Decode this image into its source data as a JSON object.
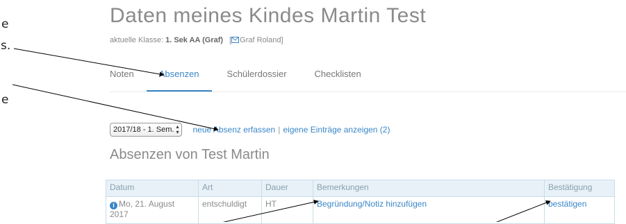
{
  "clipped_left": {
    "line1": "e",
    "line2": "s.",
    "line3": "e"
  },
  "page": {
    "title": "Daten meines Kindes Martin Test",
    "class_prefix": "aktuelle Klasse:",
    "class_value": "1. Sek AA (Graf)",
    "teacher": "Graf Roland",
    "teacher_bracket_open": "[",
    "teacher_bracket_close": "]"
  },
  "tabs": [
    {
      "label": "Noten"
    },
    {
      "label": "Absenzen"
    },
    {
      "label": "Schülerdossier"
    },
    {
      "label": "Checklisten"
    }
  ],
  "toolbar": {
    "semester_value": "2017/18 - 1. Sem.",
    "new_absence_link": "neue Absenz erfassen",
    "separator": "|",
    "own_entries_link": "eigene Einträge anzeigen (2)"
  },
  "section": {
    "title": "Absenzen von Test Martin"
  },
  "table": {
    "headers": [
      "Datum",
      "Art",
      "Dauer",
      "Bemerkungen",
      "Bestätigung"
    ],
    "rows": [
      {
        "datum": "Mo, 21. August 2017",
        "art": "entschuldigt",
        "dauer": "HT",
        "bemerkungen": "Begründung/Notiz hinzufügen",
        "bestaetigung": "bestätigen"
      }
    ]
  },
  "colors": {
    "accent": "#3a86c8",
    "header_bg": "#e7f1f7",
    "border": "#c9dde8"
  },
  "icons": [
    "mail-icon",
    "info-icon",
    "select-spinner-icon"
  ]
}
